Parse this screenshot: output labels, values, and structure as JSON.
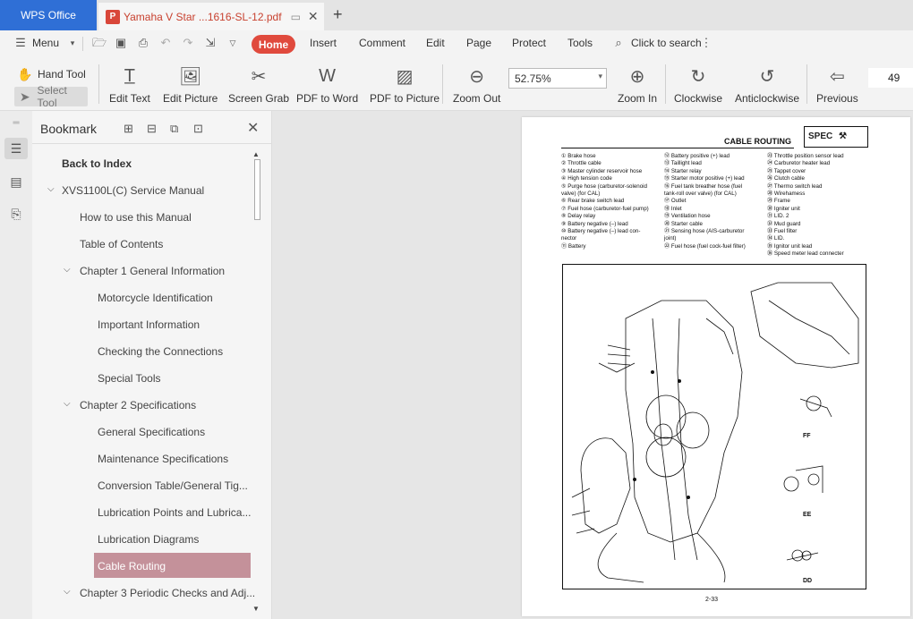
{
  "titlebar": {
    "app_tab": "WPS Office",
    "doc_tab": "Yamaha V Star ...1616-SL-12.pdf"
  },
  "menubar": {
    "menu": "Menu",
    "home": "Home",
    "items": [
      "Insert",
      "Comment",
      "Edit",
      "Page",
      "Protect",
      "Tools"
    ],
    "search": "Click to search"
  },
  "toolbar": {
    "hand_tool": "Hand Tool",
    "select_tool": "Select Tool",
    "edit_text": "Edit Text",
    "edit_picture": "Edit Picture",
    "screen_grab": "Screen Grab",
    "pdf_to_word": "PDF to Word",
    "pdf_to_picture": "PDF to Picture",
    "zoom_out": "Zoom Out",
    "zoom_level": "52.75%",
    "zoom_in": "Zoom In",
    "clockwise": "Clockwise",
    "anticlockwise": "Anticlockwise",
    "previous": "Previous",
    "page_number": "49"
  },
  "bookmark": {
    "title": "Bookmark",
    "items": [
      {
        "label": "Back to Index"
      },
      {
        "label": "XVS1100L(C) Service Manual"
      },
      {
        "label": "How to use this Manual"
      },
      {
        "label": "Table of Contents"
      },
      {
        "label": "Chapter 1 General Information"
      },
      {
        "label": "Motorcycle Identification"
      },
      {
        "label": "Important Information"
      },
      {
        "label": "Checking the Connections"
      },
      {
        "label": "Special Tools"
      },
      {
        "label": "Chapter 2 Specifications"
      },
      {
        "label": "General Specifications"
      },
      {
        "label": "Maintenance Specifications"
      },
      {
        "label": "Conversion Table/General Tig..."
      },
      {
        "label": "Lubrication Points and Lubrica..."
      },
      {
        "label": "Lubrication Diagrams"
      },
      {
        "label": "Cable Routing"
      },
      {
        "label": "Chapter 3 Periodic Checks and Adj..."
      }
    ]
  },
  "document": {
    "page_title": "CABLE ROUTING",
    "spec_badge": "SPEC",
    "legend_col1": [
      "① Brake hose",
      "② Throttle cable",
      "③ Master cylinder reservoir hose",
      "④ High tension code",
      "⑤ Purge hose (carburetor-solenoid",
      "   valve) (for CAL)",
      "⑥ Rear brake switch lead",
      "⑦ Fuel hose (carburetor-fuel pump)",
      "⑧ Delay relay",
      "⑨ Battery negative (–) lead",
      "⑩ Battery negative (–) lead con-",
      "   nector",
      "⑪ Battery"
    ],
    "legend_col2": [
      "⑫ Battery positive (+) lead",
      "⑬ Taillight lead",
      "⑭ Starter relay",
      "⑮ Starter motor positive (+) lead",
      "⑯ Fuel tank breather hose (fuel",
      "   tank-roll over valve) (for CAL)",
      "⑰ Outlet",
      "⑱ Inlet",
      "⑲ Ventilation hose",
      "⑳ Starter cable",
      "㉑ Sensing hose (AIS-carburetor",
      "   joint)",
      "㉒ Fuel hose (fuel cock-fuel filter)"
    ],
    "legend_col3": [
      "㉓ Throttle position sensor lead",
      "㉔ Carburetor heater lead",
      "㉕ Tappet cover",
      "㉖ Clutch cable",
      "㉗ Thermo switch lead",
      "㉘ Wirehamess",
      "㉙ Frame",
      "㉚ Igniter unit",
      "㉛ LID. 2",
      "㉜ Mud guard",
      "㉝ Fuel filter",
      "㉞ LID.",
      "㉟ Ignitor unit lead",
      "㊱ Speed meter lead connecter"
    ],
    "diagram_labels": {
      "ff": "FF",
      "ee": "EE",
      "dd": "DD"
    },
    "page_footer": "2-33"
  }
}
